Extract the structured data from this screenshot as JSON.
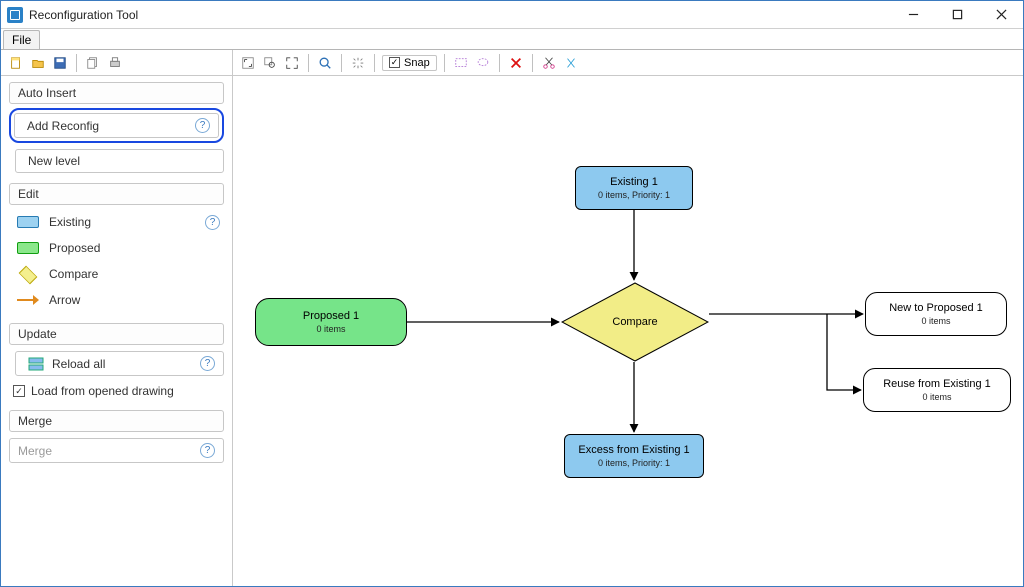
{
  "app": {
    "title": "Reconfiguration Tool"
  },
  "menu": {
    "file": "File"
  },
  "toolbar": {
    "snap_label": "Snap"
  },
  "sidebar": {
    "section_auto": "Auto Insert",
    "add_reconfig": "Add Reconfig",
    "new_level": "New level",
    "section_edit": "Edit",
    "legend": {
      "existing": "Existing",
      "proposed": "Proposed",
      "compare": "Compare",
      "arrow": "Arrow"
    },
    "section_update": "Update",
    "reload_all": "Reload all",
    "load_from_drawing": "Load from opened drawing",
    "section_merge": "Merge",
    "merge_placeholder": "Merge"
  },
  "diagram": {
    "existing1": {
      "title": "Existing 1",
      "sub": "0 items, Priority: 1"
    },
    "proposed1": {
      "title": "Proposed 1",
      "sub": "0 items"
    },
    "compare": "Compare",
    "excess": {
      "title": "Excess from Existing 1",
      "sub": "0 items, Priority: 1"
    },
    "newto": {
      "title": "New to Proposed 1",
      "sub": "0 items"
    },
    "reuse": {
      "title": "Reuse from Existing 1",
      "sub": "0 items"
    }
  }
}
